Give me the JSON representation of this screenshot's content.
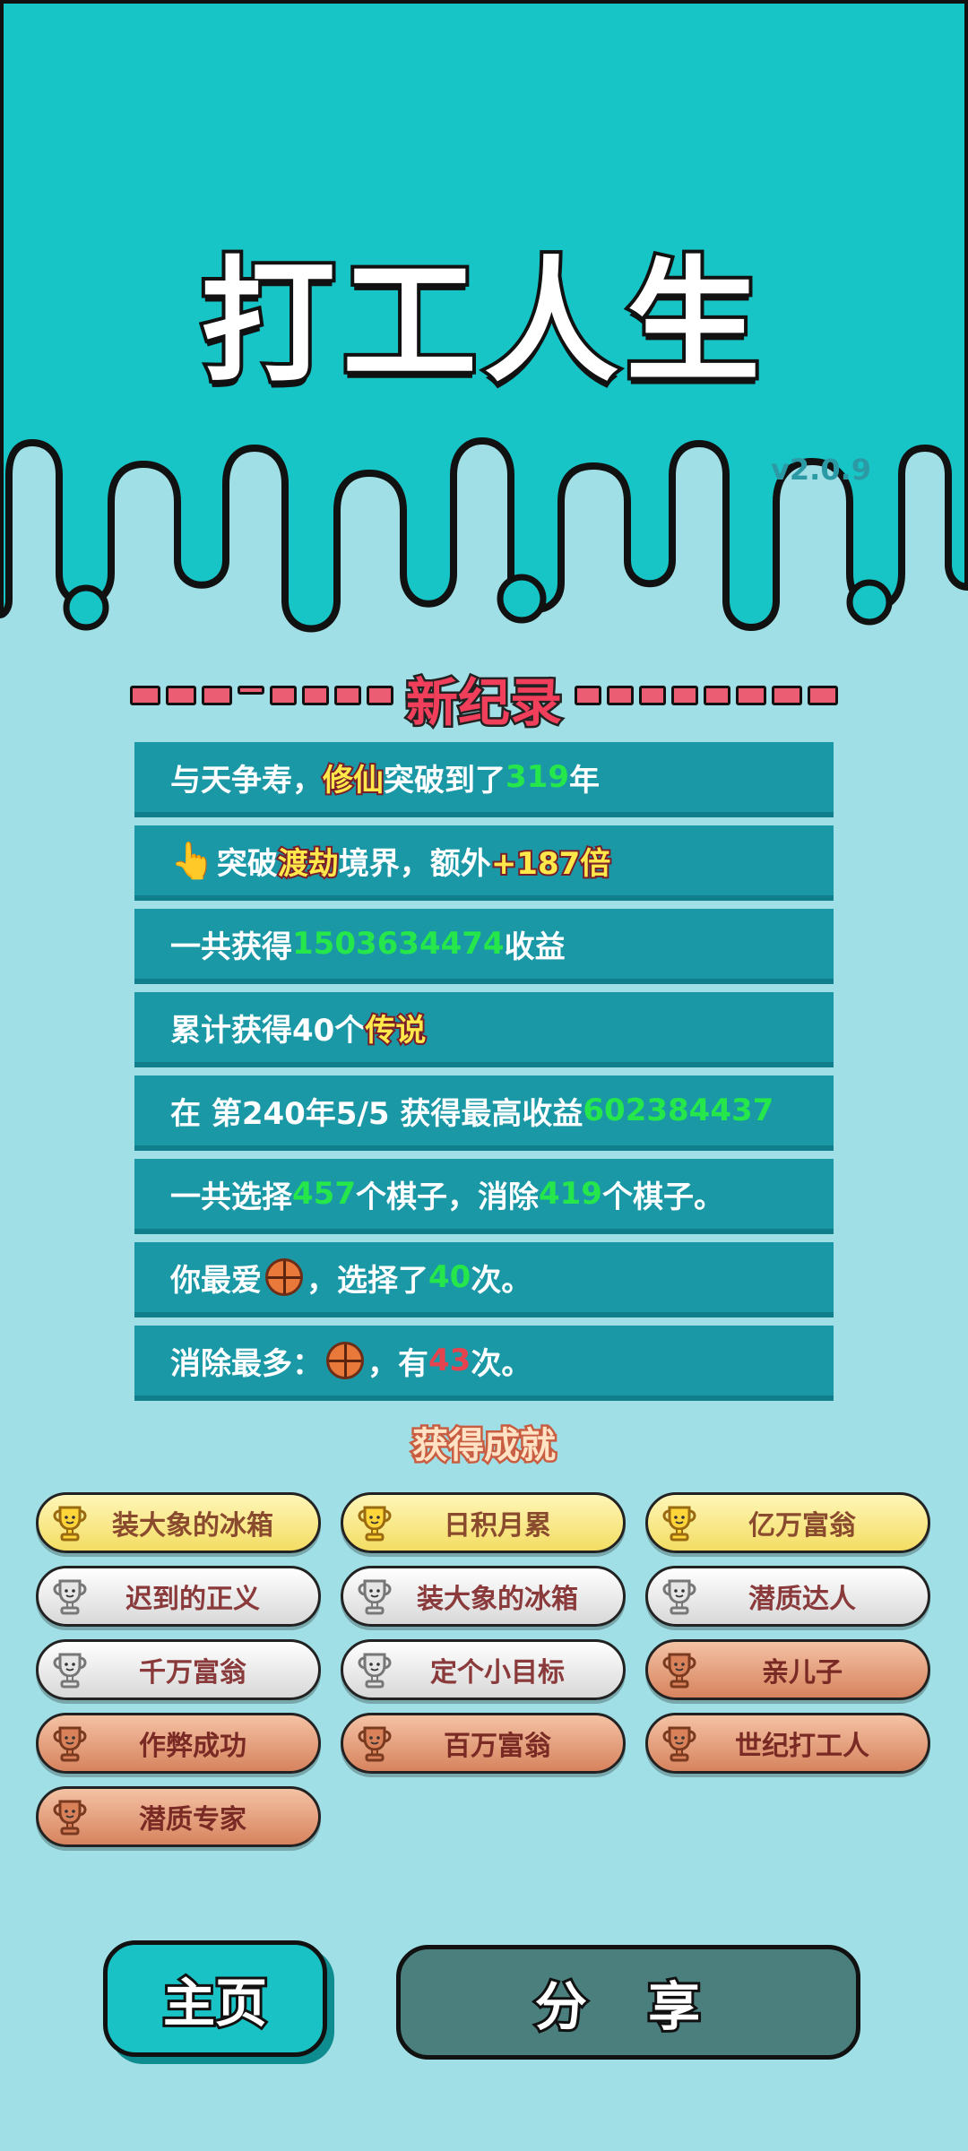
{
  "app": {
    "title": "打工人生",
    "version": "v2.0.9"
  },
  "colors": {
    "top_bg": "#17c4c6",
    "page_bg": "#a1dfe6",
    "row_bg": "#1a98a6",
    "green": "#25e64a",
    "red": "#e5434e",
    "gold_text": "#ffe94a"
  },
  "record": {
    "title": "新纪录"
  },
  "stats": {
    "row1": {
      "a": "与天争寿，",
      "b": "修仙",
      "c": "突破到了",
      "d": "319",
      "e": "年"
    },
    "row2": {
      "icon": "pointing-hand-icon",
      "a": "突破",
      "b": "渡劫",
      "c": "境界，额外",
      "d": "+187倍"
    },
    "row3": {
      "a": "一共获得",
      "b": "1503634474",
      "c": "收益"
    },
    "row4": {
      "a": "累计获得40个",
      "b": "传说"
    },
    "row5": {
      "a": "在 第240年5/5 获得最高收益",
      "b": "602384437"
    },
    "row6": {
      "a": "一共选择",
      "b": "457",
      "c": "个棋子，消除",
      "d": "419",
      "e": "个棋子。"
    },
    "row7": {
      "a": "你最爱",
      "icon": "basketball-icon",
      "b": "，选择了",
      "c": "40",
      "d": "次。"
    },
    "row8": {
      "a": "消除最多：",
      "icon": "basketball-icon",
      "b": "，有",
      "c": "43",
      "d": "次。"
    }
  },
  "achievements": {
    "title": "获得成就",
    "items": [
      {
        "label": "装大象的冰箱",
        "tier": "gold"
      },
      {
        "label": "日积月累",
        "tier": "gold"
      },
      {
        "label": "亿万富翁",
        "tier": "gold"
      },
      {
        "label": "迟到的正义",
        "tier": "silver"
      },
      {
        "label": "装大象的冰箱",
        "tier": "silver"
      },
      {
        "label": "潜质达人",
        "tier": "silver"
      },
      {
        "label": "千万富翁",
        "tier": "silver"
      },
      {
        "label": "定个小目标",
        "tier": "silver"
      },
      {
        "label": "亲儿子",
        "tier": "bronze"
      },
      {
        "label": "作弊成功",
        "tier": "bronze"
      },
      {
        "label": "百万富翁",
        "tier": "bronze"
      },
      {
        "label": "世纪打工人",
        "tier": "bronze"
      },
      {
        "label": "潜质专家",
        "tier": "bronze"
      }
    ]
  },
  "buttons": {
    "home": "主页",
    "share": "分 享"
  }
}
